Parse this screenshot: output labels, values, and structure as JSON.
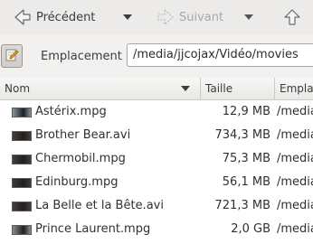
{
  "toolbar": {
    "back_label": "Précédent",
    "forward_label": "Suivant"
  },
  "location": {
    "label": "Emplacement :",
    "path": "/media/jjcojax/Vidéo/movies"
  },
  "columns": {
    "name": "Nom",
    "size": "Taille",
    "location": "Empla"
  },
  "files": [
    {
      "name": "Astérix.mpg",
      "size": "12,9 MB",
      "location": "/media",
      "thumb": "#7f97a6"
    },
    {
      "name": "Brother Bear.avi",
      "size": "734,3 MB",
      "location": "/media",
      "thumb": "#4a3b35"
    },
    {
      "name": "Chermobil.mpg",
      "size": "75,3 MB",
      "location": "/media",
      "thumb": "#3d3f42"
    },
    {
      "name": "Edinburg.mpg",
      "size": "56,1 MB",
      "location": "/media",
      "thumb": "#3b3a3c"
    },
    {
      "name": "La Belle et la Bête.avi",
      "size": "721,3 MB",
      "location": "/media",
      "thumb": "#4a3d3f"
    },
    {
      "name": "Prince Laurent.mpg",
      "size": "2,0 GB",
      "location": "/media",
      "thumb": "#8a8c8e"
    }
  ]
}
